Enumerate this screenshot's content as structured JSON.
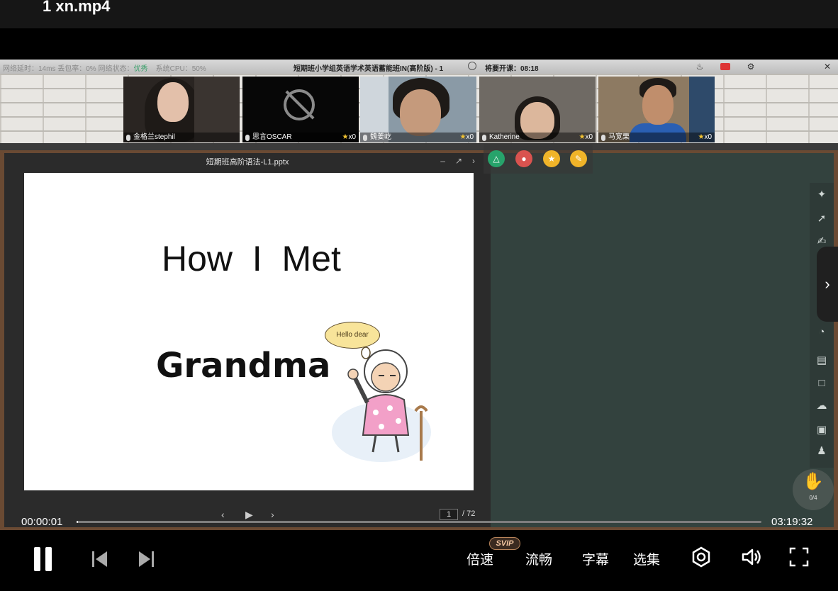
{
  "window": {
    "title": "1 xn.mp4"
  },
  "classroom": {
    "status": {
      "network": "网络延时：14ms 丢包率：0% 网络状态：",
      "network_state": "优秀",
      "cpu": "系统CPU：50%",
      "class_name": "短期班小学组英语学术英语蓄能班IN(高阶版) - 1",
      "countdown": "将要开课：08:18"
    },
    "students": [
      {
        "name": "金格兰stephil",
        "awards": ""
      },
      {
        "name": "思言OSCAR",
        "awards": "x0"
      },
      {
        "name": "魏姜屹",
        "awards": "x0"
      },
      {
        "name": "Katherine",
        "awards": "x0"
      },
      {
        "name": "马宽栗",
        "awards": "x0"
      }
    ],
    "ppt": {
      "file_name": "短期班高阶语法-L1.pptx",
      "slide_title_1": "How  I  Met",
      "slide_title_2": "Grandma",
      "speech_bubble": "Hello dear",
      "page": "1",
      "total_pages": "/ 72"
    },
    "hand_count": "0/4"
  },
  "player": {
    "current_time": "00:00:01",
    "duration": "03:19:32",
    "progress": 0.0,
    "speed_label": "倍速",
    "svip_badge": "SVIP",
    "quality_label": "流畅",
    "subtitle_label": "字幕",
    "episodes_label": "选集"
  },
  "colors": {
    "accent": "#ffffff",
    "board": "#33423e",
    "frame": "#6a4a33"
  }
}
